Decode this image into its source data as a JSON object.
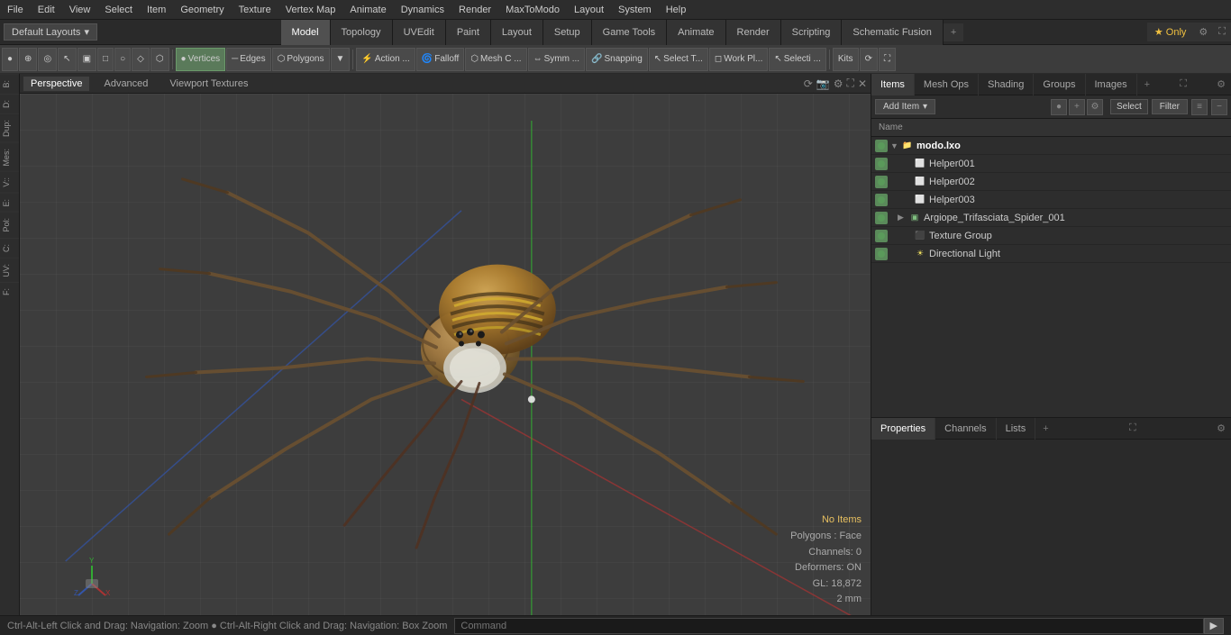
{
  "menubar": {
    "items": [
      "File",
      "Edit",
      "View",
      "Select",
      "Item",
      "Geometry",
      "Texture",
      "Vertex Map",
      "Animate",
      "Dynamics",
      "Render",
      "MaxToModo",
      "Layout",
      "System",
      "Help"
    ]
  },
  "layouts_bar": {
    "default_label": "Default Layouts",
    "tabs": [
      "Model",
      "Topology",
      "UVEdit",
      "Paint",
      "Layout",
      "Setup",
      "Game Tools",
      "Animate",
      "Render",
      "Scripting",
      "Schematic Fusion"
    ],
    "active_tab": "Model",
    "star_only": "★  Only"
  },
  "toolbar": {
    "buttons": [
      {
        "label": "●",
        "title": "perspective_toggle"
      },
      {
        "label": "⊕",
        "title": "grid_btn"
      },
      {
        "label": "◎",
        "title": "circle_btn"
      },
      {
        "label": "↖",
        "title": "select_arrow"
      },
      {
        "label": "□▣",
        "title": "box_select"
      },
      {
        "label": "▣",
        "title": "rect_select"
      },
      {
        "label": "○",
        "title": "circle_select"
      },
      {
        "label": "◇",
        "title": "lasso_select"
      },
      {
        "label": "⬡",
        "title": "hex_btn"
      },
      {
        "label": "▪",
        "title": "dot_btn"
      }
    ],
    "mode_buttons": [
      "Vertices",
      "Edges",
      "Polygons"
    ],
    "action_label": "Action ...",
    "falloff_label": "Falloff",
    "mesh_label": "Mesh C ...",
    "symm_label": "Symm ...",
    "snapping_label": "Snapping",
    "select_tool_label": "Select T...",
    "work_plane_label": "Work Pl...",
    "selection_label": "Selecti ...",
    "kits_label": "Kits"
  },
  "viewport": {
    "tabs": [
      "Perspective",
      "Advanced",
      "Viewport Textures"
    ],
    "active_tab": "Perspective"
  },
  "viewport_info": {
    "no_items": "No Items",
    "polygons": "Polygons : Face",
    "channels": "Channels: 0",
    "deformers": "Deformers: ON",
    "gl": "GL: 18,872",
    "size": "2 mm"
  },
  "right_panel": {
    "tabs": [
      "Items",
      "Mesh Ops",
      "Shading",
      "Groups",
      "Images"
    ],
    "active_tab": "Items",
    "add_item_label": "Add Item",
    "select_label": "Select",
    "filter_label": "Filter",
    "col_header": "Name",
    "items": [
      {
        "id": "modo_bxo",
        "name": "modo.lxo",
        "level": 0,
        "icon": "scene",
        "expanded": true,
        "visible": true
      },
      {
        "id": "helper001",
        "name": "Helper001",
        "level": 1,
        "icon": "helper",
        "expanded": false,
        "visible": true
      },
      {
        "id": "helper002",
        "name": "Helper002",
        "level": 1,
        "icon": "helper",
        "expanded": false,
        "visible": true
      },
      {
        "id": "helper003",
        "name": "Helper003",
        "level": 1,
        "icon": "helper",
        "expanded": false,
        "visible": true
      },
      {
        "id": "spider",
        "name": "Argiope_Trifasciata_Spider_001",
        "level": 1,
        "icon": "mesh",
        "expanded": false,
        "visible": true
      },
      {
        "id": "texture_group",
        "name": "Texture Group",
        "level": 1,
        "icon": "texture",
        "expanded": false,
        "visible": true
      },
      {
        "id": "dir_light",
        "name": "Directional Light",
        "level": 1,
        "icon": "light",
        "expanded": false,
        "visible": true
      }
    ]
  },
  "properties_panel": {
    "tabs": [
      "Properties",
      "Channels",
      "Lists"
    ],
    "active_tab": "Properties"
  },
  "status_bar": {
    "hint": "Ctrl-Alt-Left Click and Drag: Navigation: Zoom  ●  Ctrl-Alt-Right Click and Drag: Navigation: Box Zoom",
    "command_placeholder": "Command"
  },
  "left_sidebar": {
    "tabs": [
      "B:",
      "D:",
      "Dup:",
      "Mes:",
      "V::",
      "E:",
      "Pol:",
      "C:",
      "UV:",
      "F:"
    ]
  },
  "colors": {
    "accent_blue": "#4a8abf",
    "active_green": "#5a9a5a",
    "bg_dark": "#2d2d2d",
    "bg_mid": "#3a3a3a",
    "border": "#1a1a1a",
    "text_light": "#cccccc",
    "text_highlight": "#e8c060"
  }
}
